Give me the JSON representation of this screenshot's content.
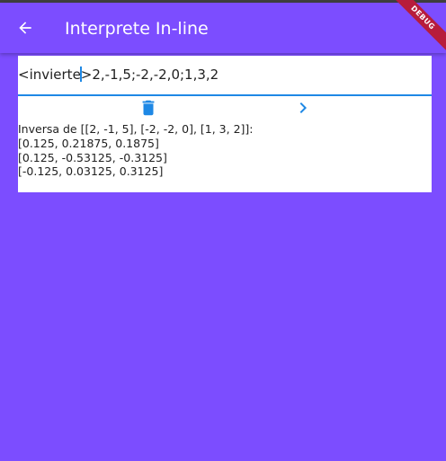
{
  "appbar": {
    "title": "Interprete In-line",
    "back_icon": "arrow-back-icon",
    "debug_banner": "DEBUG"
  },
  "input": {
    "value_before_caret": "<invierte",
    "value_after_caret": ">2,-1,5;-2,-2,0;1,3,2"
  },
  "actions": {
    "delete_icon": "trash-icon",
    "run_icon": "chevron-right-icon"
  },
  "output": {
    "lines": [
      "Inversa de [[2, -1, 5], [-2, -2, 0], [1, 3, 2]]:",
      "[0.125, 0.21875, 0.1875]",
      "[0.125, -0.53125, -0.3125]",
      "[-0.125, 0.03125, 0.3125]"
    ]
  },
  "colors": {
    "background": "#7c4dff",
    "accent": "#1e88e5",
    "banner": "#b71c3c"
  }
}
